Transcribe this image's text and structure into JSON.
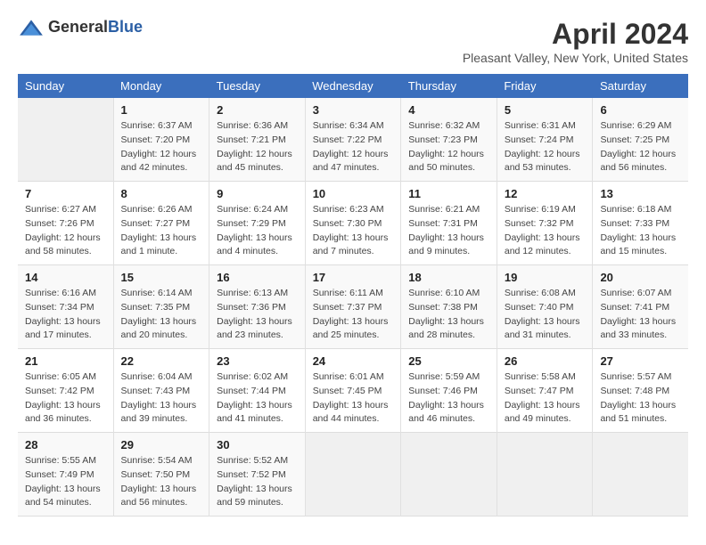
{
  "header": {
    "logo_general": "General",
    "logo_blue": "Blue",
    "month": "April 2024",
    "location": "Pleasant Valley, New York, United States"
  },
  "columns": [
    "Sunday",
    "Monday",
    "Tuesday",
    "Wednesday",
    "Thursday",
    "Friday",
    "Saturday"
  ],
  "weeks": [
    [
      {
        "day": "",
        "info": ""
      },
      {
        "day": "1",
        "info": "Sunrise: 6:37 AM\nSunset: 7:20 PM\nDaylight: 12 hours\nand 42 minutes."
      },
      {
        "day": "2",
        "info": "Sunrise: 6:36 AM\nSunset: 7:21 PM\nDaylight: 12 hours\nand 45 minutes."
      },
      {
        "day": "3",
        "info": "Sunrise: 6:34 AM\nSunset: 7:22 PM\nDaylight: 12 hours\nand 47 minutes."
      },
      {
        "day": "4",
        "info": "Sunrise: 6:32 AM\nSunset: 7:23 PM\nDaylight: 12 hours\nand 50 minutes."
      },
      {
        "day": "5",
        "info": "Sunrise: 6:31 AM\nSunset: 7:24 PM\nDaylight: 12 hours\nand 53 minutes."
      },
      {
        "day": "6",
        "info": "Sunrise: 6:29 AM\nSunset: 7:25 PM\nDaylight: 12 hours\nand 56 minutes."
      }
    ],
    [
      {
        "day": "7",
        "info": "Sunrise: 6:27 AM\nSunset: 7:26 PM\nDaylight: 12 hours\nand 58 minutes."
      },
      {
        "day": "8",
        "info": "Sunrise: 6:26 AM\nSunset: 7:27 PM\nDaylight: 13 hours\nand 1 minute."
      },
      {
        "day": "9",
        "info": "Sunrise: 6:24 AM\nSunset: 7:29 PM\nDaylight: 13 hours\nand 4 minutes."
      },
      {
        "day": "10",
        "info": "Sunrise: 6:23 AM\nSunset: 7:30 PM\nDaylight: 13 hours\nand 7 minutes."
      },
      {
        "day": "11",
        "info": "Sunrise: 6:21 AM\nSunset: 7:31 PM\nDaylight: 13 hours\nand 9 minutes."
      },
      {
        "day": "12",
        "info": "Sunrise: 6:19 AM\nSunset: 7:32 PM\nDaylight: 13 hours\nand 12 minutes."
      },
      {
        "day": "13",
        "info": "Sunrise: 6:18 AM\nSunset: 7:33 PM\nDaylight: 13 hours\nand 15 minutes."
      }
    ],
    [
      {
        "day": "14",
        "info": "Sunrise: 6:16 AM\nSunset: 7:34 PM\nDaylight: 13 hours\nand 17 minutes."
      },
      {
        "day": "15",
        "info": "Sunrise: 6:14 AM\nSunset: 7:35 PM\nDaylight: 13 hours\nand 20 minutes."
      },
      {
        "day": "16",
        "info": "Sunrise: 6:13 AM\nSunset: 7:36 PM\nDaylight: 13 hours\nand 23 minutes."
      },
      {
        "day": "17",
        "info": "Sunrise: 6:11 AM\nSunset: 7:37 PM\nDaylight: 13 hours\nand 25 minutes."
      },
      {
        "day": "18",
        "info": "Sunrise: 6:10 AM\nSunset: 7:38 PM\nDaylight: 13 hours\nand 28 minutes."
      },
      {
        "day": "19",
        "info": "Sunrise: 6:08 AM\nSunset: 7:40 PM\nDaylight: 13 hours\nand 31 minutes."
      },
      {
        "day": "20",
        "info": "Sunrise: 6:07 AM\nSunset: 7:41 PM\nDaylight: 13 hours\nand 33 minutes."
      }
    ],
    [
      {
        "day": "21",
        "info": "Sunrise: 6:05 AM\nSunset: 7:42 PM\nDaylight: 13 hours\nand 36 minutes."
      },
      {
        "day": "22",
        "info": "Sunrise: 6:04 AM\nSunset: 7:43 PM\nDaylight: 13 hours\nand 39 minutes."
      },
      {
        "day": "23",
        "info": "Sunrise: 6:02 AM\nSunset: 7:44 PM\nDaylight: 13 hours\nand 41 minutes."
      },
      {
        "day": "24",
        "info": "Sunrise: 6:01 AM\nSunset: 7:45 PM\nDaylight: 13 hours\nand 44 minutes."
      },
      {
        "day": "25",
        "info": "Sunrise: 5:59 AM\nSunset: 7:46 PM\nDaylight: 13 hours\nand 46 minutes."
      },
      {
        "day": "26",
        "info": "Sunrise: 5:58 AM\nSunset: 7:47 PM\nDaylight: 13 hours\nand 49 minutes."
      },
      {
        "day": "27",
        "info": "Sunrise: 5:57 AM\nSunset: 7:48 PM\nDaylight: 13 hours\nand 51 minutes."
      }
    ],
    [
      {
        "day": "28",
        "info": "Sunrise: 5:55 AM\nSunset: 7:49 PM\nDaylight: 13 hours\nand 54 minutes."
      },
      {
        "day": "29",
        "info": "Sunrise: 5:54 AM\nSunset: 7:50 PM\nDaylight: 13 hours\nand 56 minutes."
      },
      {
        "day": "30",
        "info": "Sunrise: 5:52 AM\nSunset: 7:52 PM\nDaylight: 13 hours\nand 59 minutes."
      },
      {
        "day": "",
        "info": ""
      },
      {
        "day": "",
        "info": ""
      },
      {
        "day": "",
        "info": ""
      },
      {
        "day": "",
        "info": ""
      }
    ]
  ]
}
